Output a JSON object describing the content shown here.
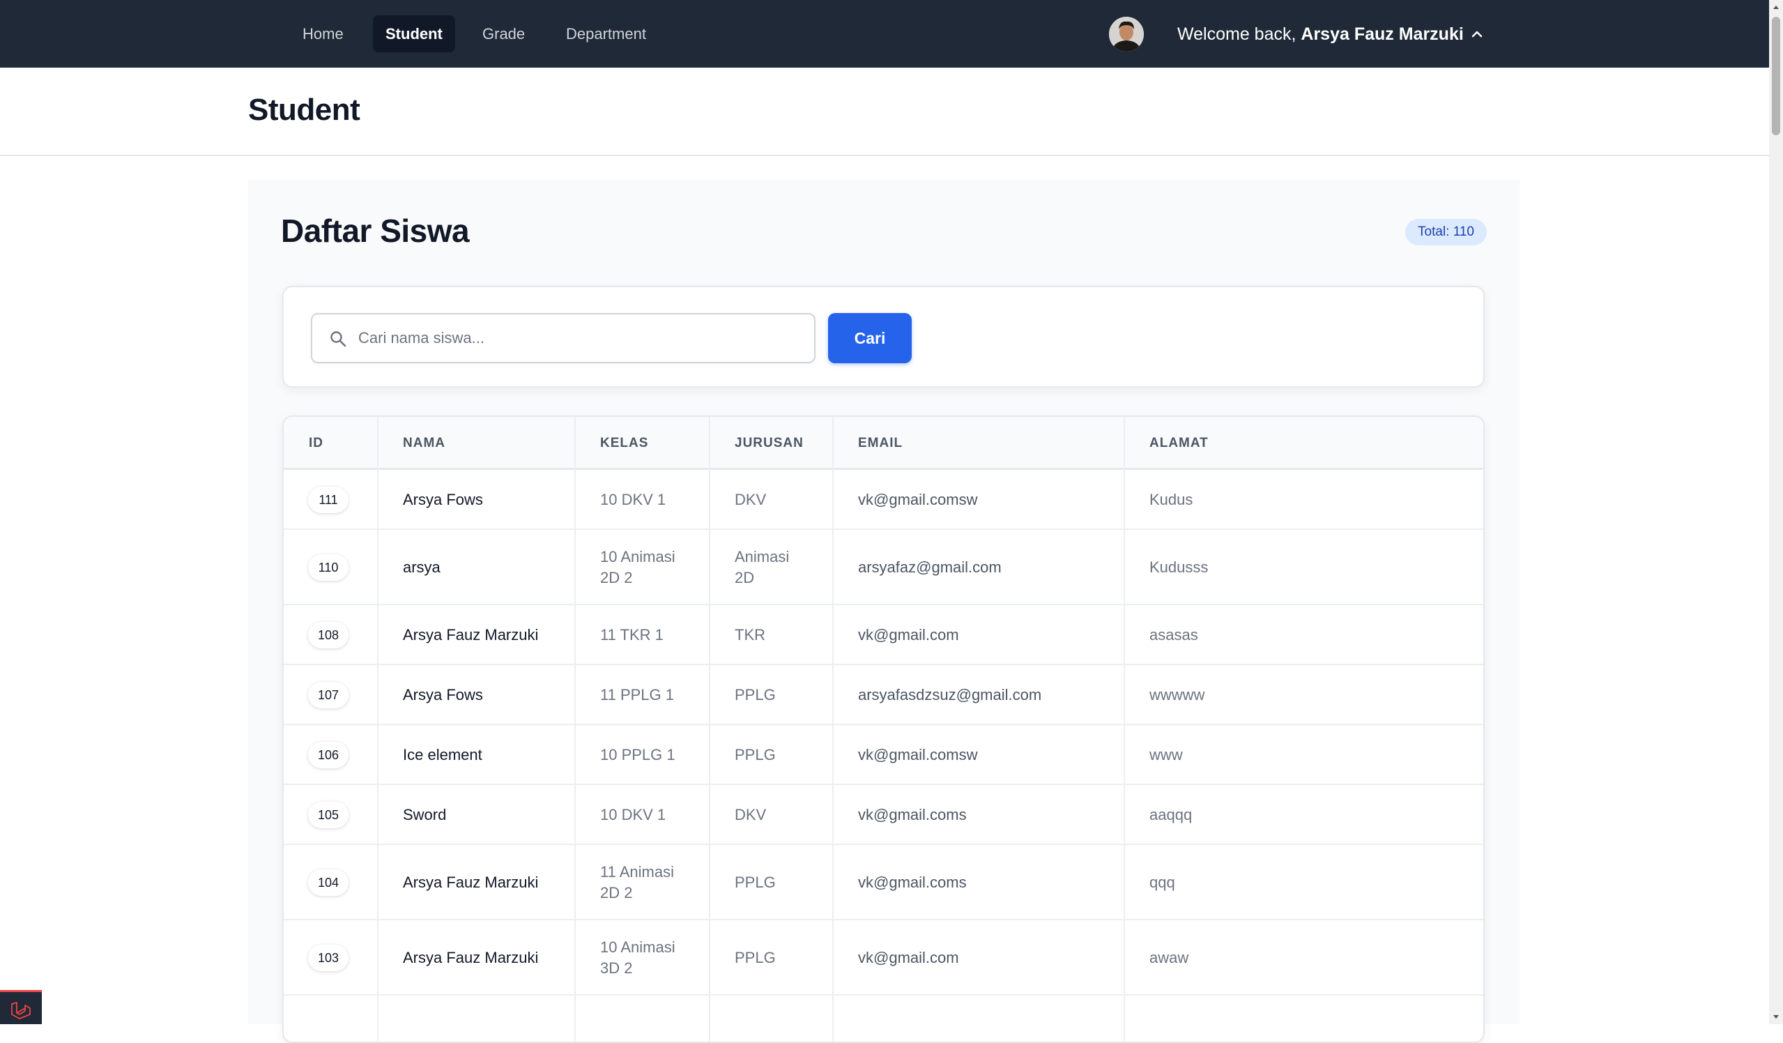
{
  "nav": {
    "links": [
      "Home",
      "Student",
      "Grade",
      "Department"
    ],
    "active": "Student",
    "welcome_prefix": "Welcome back,",
    "user_name": "Arsya Fauz Marzuki"
  },
  "header": {
    "title": "Student"
  },
  "section": {
    "title": "Daftar Siswa",
    "total": "Total: 110"
  },
  "search": {
    "placeholder": "Cari nama siswa...",
    "value": "",
    "button": "Cari"
  },
  "table": {
    "headers": [
      "ID",
      "NAMA",
      "KELAS",
      "JURUSAN",
      "EMAIL",
      "ALAMAT"
    ],
    "rows": [
      {
        "id": "111",
        "nama": "Arsya Fows",
        "kelas": [
          "10 DKV 1"
        ],
        "jurusan": [
          "DKV"
        ],
        "email": "vk@gmail.comsw",
        "alamat": "Kudus"
      },
      {
        "id": "110",
        "nama": "arsya",
        "kelas": [
          "10 Animasi",
          "2D 2"
        ],
        "jurusan": [
          "Animasi",
          "2D"
        ],
        "email": "arsyafaz@gmail.com",
        "alamat": "Kudusss"
      },
      {
        "id": "108",
        "nama": "Arsya Fauz Marzuki",
        "kelas": [
          "11 TKR 1"
        ],
        "jurusan": [
          "TKR"
        ],
        "email": "vk@gmail.com",
        "alamat": "asasas"
      },
      {
        "id": "107",
        "nama": "Arsya Fows",
        "kelas": [
          "11 PPLG 1"
        ],
        "jurusan": [
          "PPLG"
        ],
        "email": "arsyafasdzsuz@gmail.com",
        "alamat": "wwwww"
      },
      {
        "id": "106",
        "nama": "Ice element",
        "kelas": [
          "10 PPLG 1"
        ],
        "jurusan": [
          "PPLG"
        ],
        "email": "vk@gmail.comsw",
        "alamat": "www"
      },
      {
        "id": "105",
        "nama": "Sword",
        "kelas": [
          "10 DKV 1"
        ],
        "jurusan": [
          "DKV"
        ],
        "email": "vk@gmail.coms",
        "alamat": "aaqqq"
      },
      {
        "id": "104",
        "nama": "Arsya Fauz Marzuki",
        "kelas": [
          "11 Animasi",
          "2D 2"
        ],
        "jurusan": [
          "PPLG"
        ],
        "email": "vk@gmail.coms",
        "alamat": "qqq"
      },
      {
        "id": "103",
        "nama": "Arsya Fauz Marzuki",
        "kelas": [
          "10 Animasi",
          "3D 2"
        ],
        "jurusan": [
          "PPLG"
        ],
        "email": "vk@gmail.com",
        "alamat": "awaw"
      }
    ]
  },
  "colors": {
    "navbar": "#1f2937",
    "accent": "#2563eb",
    "badge_bg": "#dbeafe",
    "badge_text": "#1e40af"
  },
  "icons": {
    "search": "search-icon",
    "chevron": "chevron-up-icon",
    "framework": "laravel-icon"
  }
}
